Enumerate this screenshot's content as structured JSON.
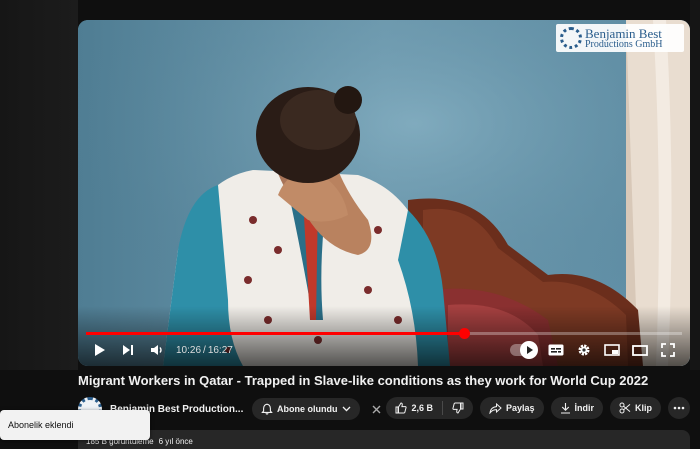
{
  "player": {
    "watermark": {
      "line1": "Benjamin Best",
      "line2": "Productions GmbH"
    },
    "time": {
      "current": "10:26",
      "separator": "/",
      "duration": "16:27"
    },
    "progress_fraction": 0.634,
    "controls": [
      "play-icon",
      "next-icon",
      "volume-icon",
      "autoplay-toggle",
      "subtitles-icon",
      "settings-icon",
      "miniplayer-icon",
      "theater-icon",
      "fullscreen-icon"
    ]
  },
  "video": {
    "title": "Migrant Workers in Qatar - Trapped in Slave-like conditions as they work for World Cup 2022"
  },
  "channel": {
    "name": "Benjamin Best Production...",
    "subscribe_label": "Abone olundu"
  },
  "actions": {
    "like_count": "2,6 B",
    "share_label": "Paylaş",
    "download_label": "İndir",
    "clip_label": "Klip"
  },
  "description": {
    "views": "185 B görüntüleme",
    "age": "6 yıl önce"
  },
  "toast": {
    "message": "Abonelik eklendi"
  },
  "colors": {
    "progress": "#ff0000",
    "background": "#0f0f0f",
    "pill": "#272727"
  }
}
